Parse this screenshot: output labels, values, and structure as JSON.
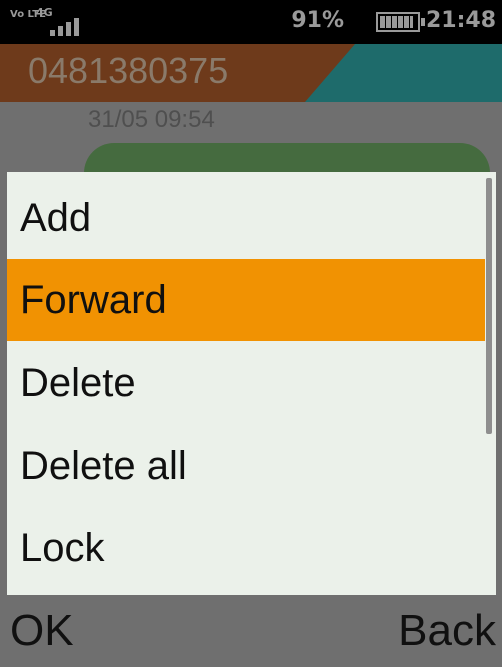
{
  "status_bar": {
    "volte_label": "Vo LTE",
    "network_label": "4G",
    "battery_percent_text": "91%",
    "battery_level": 0.91,
    "time": "21:48"
  },
  "conversation": {
    "contact_number": "0481380375",
    "timestamp": "31/05 09:54"
  },
  "options_menu": {
    "items": [
      {
        "label": "Add",
        "selected": false
      },
      {
        "label": "Forward",
        "selected": true
      },
      {
        "label": "Delete",
        "selected": false
      },
      {
        "label": "Delete all",
        "selected": false
      },
      {
        "label": "Lock",
        "selected": false
      }
    ]
  },
  "softkeys": {
    "left_label": "OK",
    "right_label": "Back"
  },
  "colors": {
    "selection": "#f19202",
    "menu_background": "#ebf1ea",
    "header_left": "#6e3a1b",
    "header_right": "#1e6b6b"
  },
  "icons": {
    "signal": "signal-bars-icon",
    "battery": "battery-icon"
  }
}
